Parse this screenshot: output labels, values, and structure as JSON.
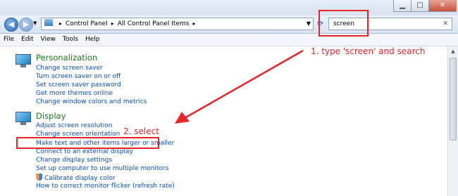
{
  "window": {
    "minimize_glyph": "▁",
    "maximize_glyph": "□",
    "close_glyph": "✕"
  },
  "nav": {
    "back_glyph": "◀",
    "forward_glyph": "▶",
    "breadcrumb": [
      "Control Panel",
      "All Control Panel Items"
    ],
    "search_value": "screen",
    "search_clear_glyph": "✕"
  },
  "menu": [
    "File",
    "Edit",
    "View",
    "Tools",
    "Help"
  ],
  "categories": [
    {
      "title": "Personalization",
      "links": [
        "Change screen saver",
        "Turn screen saver on or off",
        "Set screen saver password",
        "Get more themes online",
        "Change window colors and metrics"
      ]
    },
    {
      "title": "Display",
      "links": [
        "Adjust screen resolution",
        "Change screen orientation",
        "Make text and other items larger or smaller",
        "Connect to an external display",
        "Change display settings",
        "Set up computer to use multiple monitors",
        "Calibrate display color",
        "How to correct monitor flicker (refresh rate)"
      ]
    }
  ],
  "annotations": {
    "step1": "1. type 'screen' and search",
    "step2": "2. select",
    "color": "#e8262a"
  }
}
